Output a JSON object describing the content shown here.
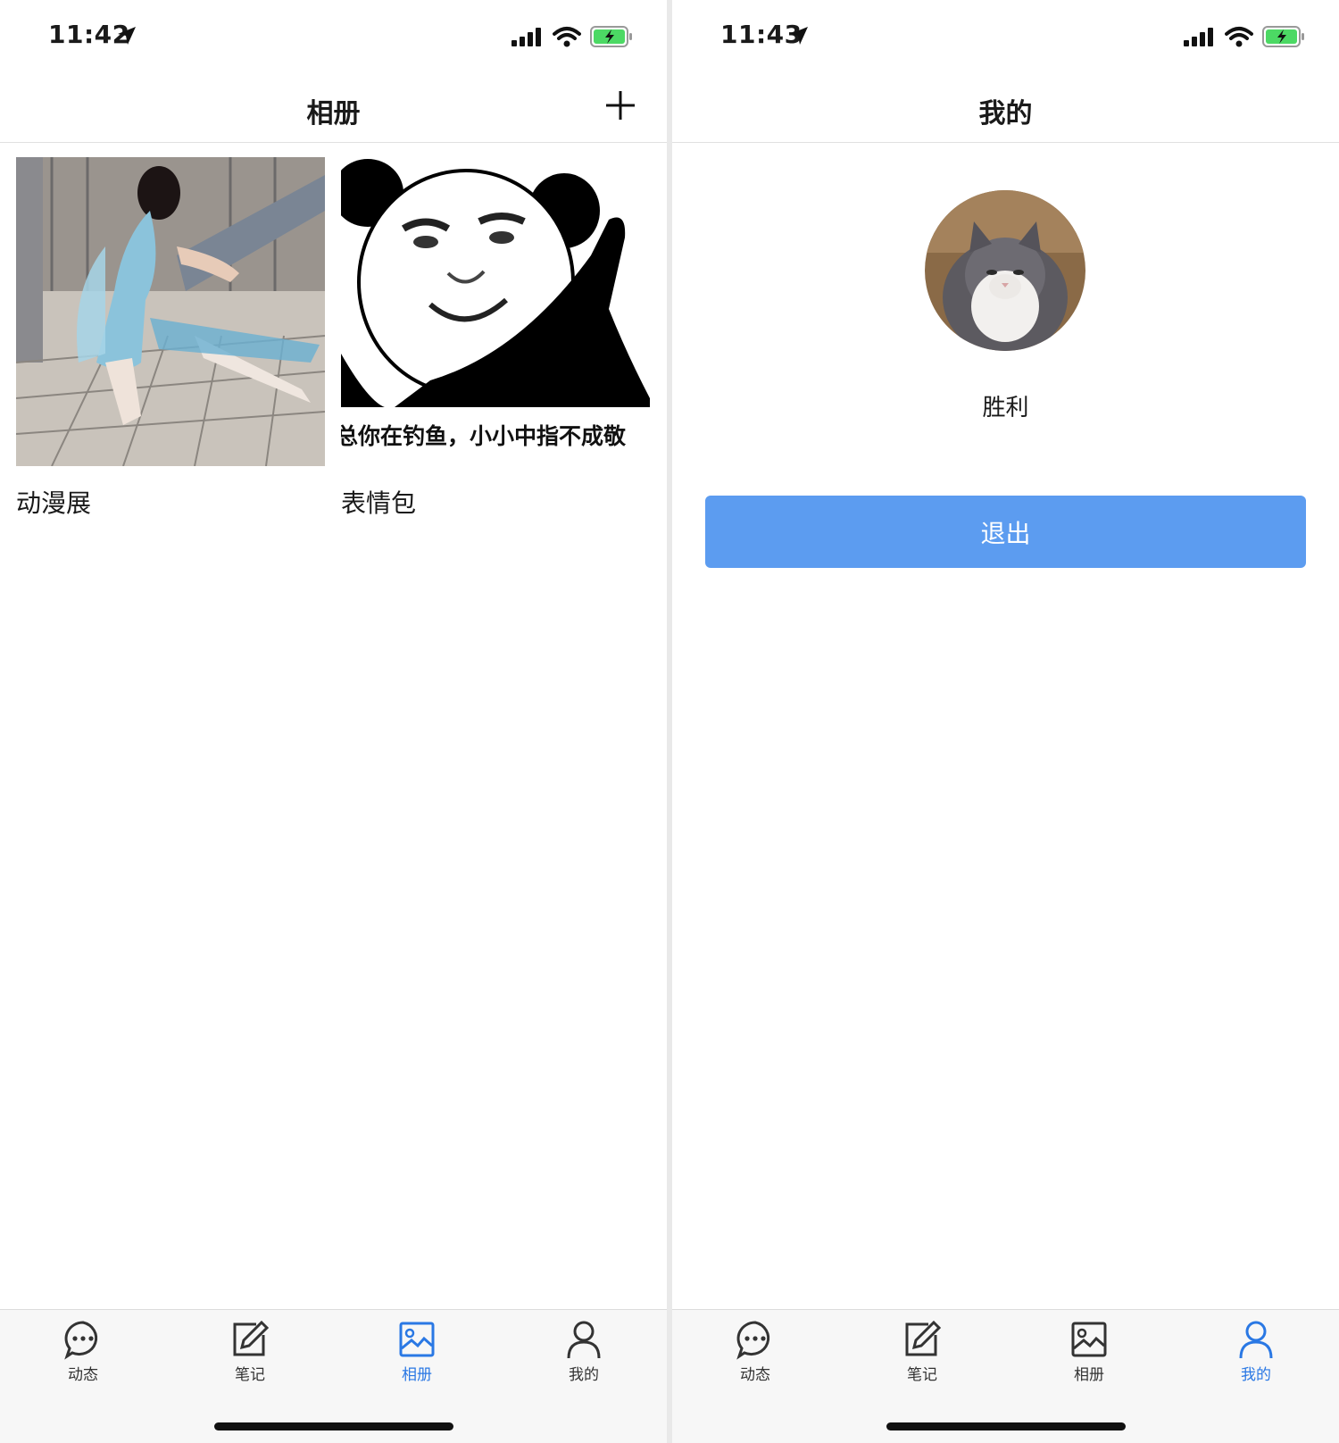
{
  "left_screen": {
    "status": {
      "time": "11:42"
    },
    "nav": {
      "title": "相册",
      "add_icon": "plus-icon"
    },
    "albums": [
      {
        "name": "动漫展",
        "thumb": "cosplay-photo"
      },
      {
        "name": "表情包",
        "thumb": "panda-meme",
        "caption": "总你在钓鱼，小小中指不成敬"
      }
    ],
    "tabs": [
      {
        "label": "动态",
        "icon": "chat-bubble-icon",
        "active": false
      },
      {
        "label": "笔记",
        "icon": "edit-icon",
        "active": false
      },
      {
        "label": "相册",
        "icon": "image-icon",
        "active": true
      },
      {
        "label": "我的",
        "icon": "person-icon",
        "active": false
      }
    ]
  },
  "right_screen": {
    "status": {
      "time": "11:43"
    },
    "nav": {
      "title": "我的"
    },
    "profile": {
      "name": "胜利",
      "avatar": "cat-avatar"
    },
    "logout_label": "退出",
    "tabs": [
      {
        "label": "动态",
        "icon": "chat-bubble-icon",
        "active": false
      },
      {
        "label": "笔记",
        "icon": "edit-icon",
        "active": false
      },
      {
        "label": "相册",
        "icon": "image-icon",
        "active": false
      },
      {
        "label": "我的",
        "icon": "person-icon",
        "active": true
      }
    ]
  },
  "colors": {
    "accent": "#2a78e4",
    "button": "#5c9cf0",
    "battery": "#4cd964"
  }
}
